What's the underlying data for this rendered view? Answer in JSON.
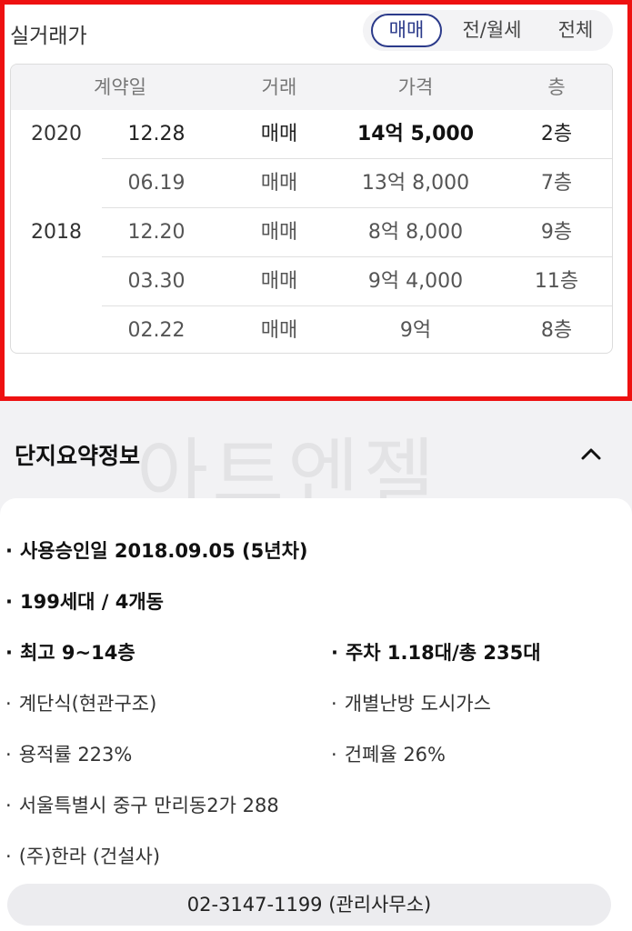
{
  "trade": {
    "title": "실거래가",
    "tabs": [
      {
        "label": "매매",
        "active": true
      },
      {
        "label": "전/월세",
        "active": false
      },
      {
        "label": "전체",
        "active": false
      }
    ],
    "columns": [
      "계약일",
      "거래",
      "가격",
      "층"
    ],
    "rows": [
      {
        "year": "2020",
        "date": "12.28",
        "type": "매매",
        "price": "14억 5,000",
        "floor": "2층"
      },
      {
        "year": "",
        "date": "06.19",
        "type": "매매",
        "price": "13억 8,000",
        "floor": "7층"
      },
      {
        "year": "2018",
        "date": "12.20",
        "type": "매매",
        "price": "8억 8,000",
        "floor": "9층"
      },
      {
        "year": "",
        "date": "03.30",
        "type": "매매",
        "price": "9억 4,000",
        "floor": "11층"
      },
      {
        "year": "",
        "date": "02.22",
        "type": "매매",
        "price": "9억",
        "floor": "8층"
      }
    ],
    "highlight_color": "#ee1111"
  },
  "watermark": "아트엔젤",
  "summary": {
    "title": "단지요약정보",
    "approval": "사용승인일 2018.09.05 (5년차)",
    "households": "199세대 / 4개동",
    "floors": "최고 9~14층",
    "parking": "주차 1.18대/총 235대",
    "structure": "계단식(현관구조)",
    "heating": "개별난방 도시가스",
    "far": "용적률 223%",
    "bcr": "건폐율 26%",
    "address": "서울특별시 중구 만리동2가 288",
    "builder": "(주)한라 (건설사)",
    "phone": "02-3147-1199 (관리사무소)"
  }
}
